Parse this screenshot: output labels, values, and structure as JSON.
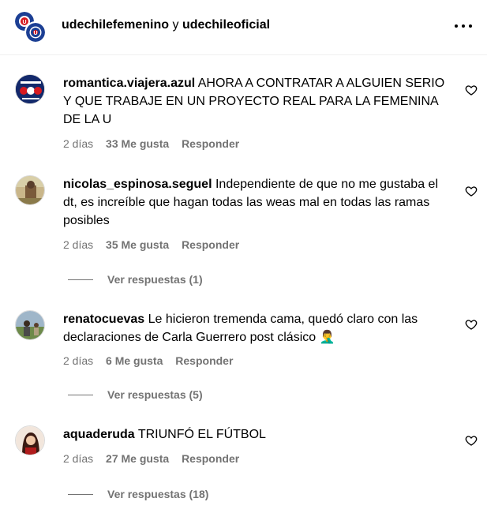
{
  "header": {
    "user1": "udechilefemenino",
    "connector": "y",
    "user2": "udechileoficial",
    "more_icon": "more-horizontal-icon"
  },
  "comments": [
    {
      "username": "romantica.viajera.azul",
      "text": "AHORA A CONTRATAR A ALGUIEN SERIO Y QUE TRABAJE EN UN PROYECTO REAL PARA LA FEMENINA DE LA U",
      "time": "2 días",
      "likes": "33 Me gusta",
      "reply": "Responder"
    },
    {
      "username": "nicolas_espinosa.seguel",
      "text": "Independiente de que no me gustaba el dt, es increíble que hagan todas las weas mal en todas las ramas posibles",
      "time": "2 días",
      "likes": "35 Me gusta",
      "reply": "Responder",
      "view_replies": "Ver respuestas (1)"
    },
    {
      "username": "renatocuevas",
      "text": "Le hicieron tremenda cama, quedó claro con las declaraciones de Carla Guerrero post clásico",
      "emoji": "🤦‍♂️",
      "time": "2 días",
      "likes": "6 Me gusta",
      "reply": "Responder",
      "view_replies": "Ver respuestas (5)"
    },
    {
      "username": "aquaderuda",
      "text": "TRIUNFÓ EL FÚTBOL",
      "time": "2 días",
      "likes": "27 Me gusta",
      "reply": "Responder",
      "view_replies": "Ver respuestas (18)"
    }
  ],
  "colors": {
    "meta_text": "#737373",
    "divider": "#efefef",
    "udechile_blue": "#1c3f94",
    "udechile_red": "#d71920"
  }
}
